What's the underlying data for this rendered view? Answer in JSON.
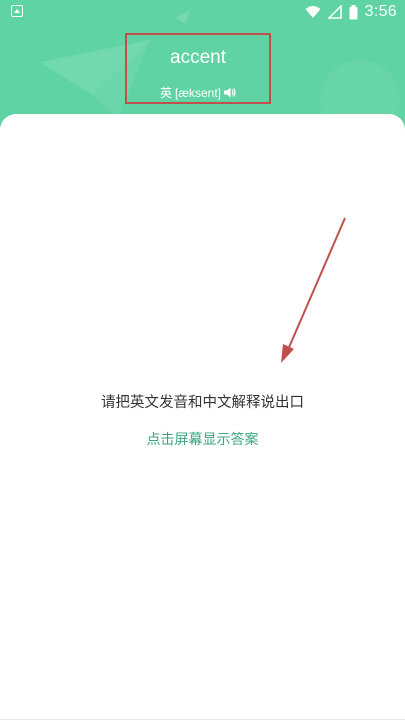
{
  "status_bar": {
    "time": "3:56",
    "left_icon": "app-notification-icon",
    "right_icons": [
      "wifi-icon",
      "signal-icon",
      "battery-icon"
    ]
  },
  "word_card": {
    "word": "accent",
    "lang_label": "英",
    "phonetic": "[æksent]",
    "speaker_icon": "speaker-icon"
  },
  "main": {
    "prompt": "请把英文发音和中文解释说出口",
    "reveal_hint": "点击屏幕显示答案"
  },
  "colors": {
    "header_bg": "#5fd3a4",
    "hint_text": "#3aa57e",
    "annotation": "#c0504d"
  }
}
